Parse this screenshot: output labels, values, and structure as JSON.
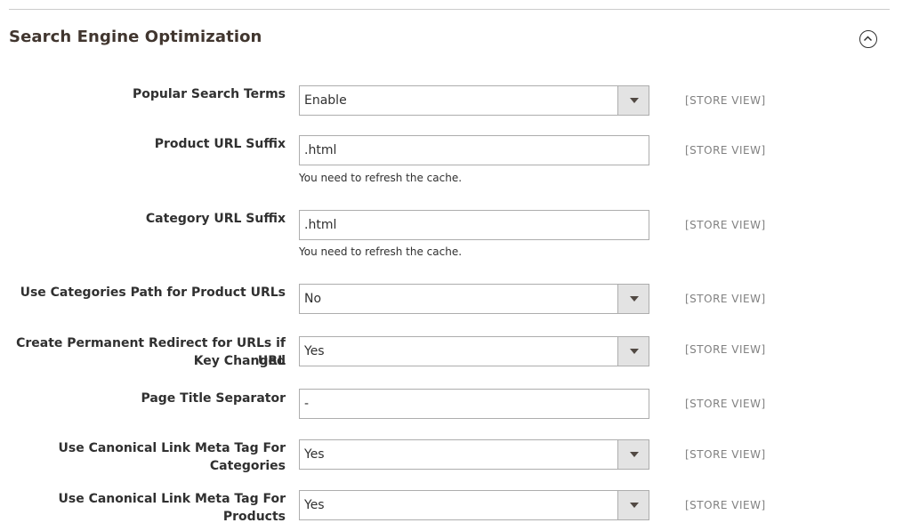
{
  "section": {
    "title": "Search Engine Optimization",
    "collapse_icon": "chevron-up-circle-icon"
  },
  "fields": [
    {
      "label": "Popular Search Terms",
      "type": "select",
      "value": "Enable",
      "scope": "[STORE VIEW]"
    },
    {
      "label": "Product URL Suffix",
      "type": "text",
      "value": ".html",
      "note": "You need to refresh the cache.",
      "scope": "[STORE VIEW]"
    },
    {
      "label": "Category URL Suffix",
      "type": "text",
      "value": ".html",
      "note": "You need to refresh the cache.",
      "scope": "[STORE VIEW]"
    },
    {
      "label": "Use Categories Path for Product URLs",
      "type": "select",
      "value": "No",
      "scope": "[STORE VIEW]"
    },
    {
      "label_line1": "Create Permanent Redirect for URLs if URL",
      "label_line2": "Key Changed",
      "type": "select",
      "value": "Yes",
      "scope": "[STORE VIEW]"
    },
    {
      "label": "Page Title Separator",
      "type": "text",
      "value": "-",
      "scope": "[STORE VIEW]"
    },
    {
      "label": "Use Canonical Link Meta Tag For Categories",
      "type": "select",
      "value": "Yes",
      "scope": "[STORE VIEW]"
    },
    {
      "label": "Use Canonical Link Meta Tag For Products",
      "type": "select",
      "value": "Yes",
      "scope": "[STORE VIEW]"
    }
  ]
}
